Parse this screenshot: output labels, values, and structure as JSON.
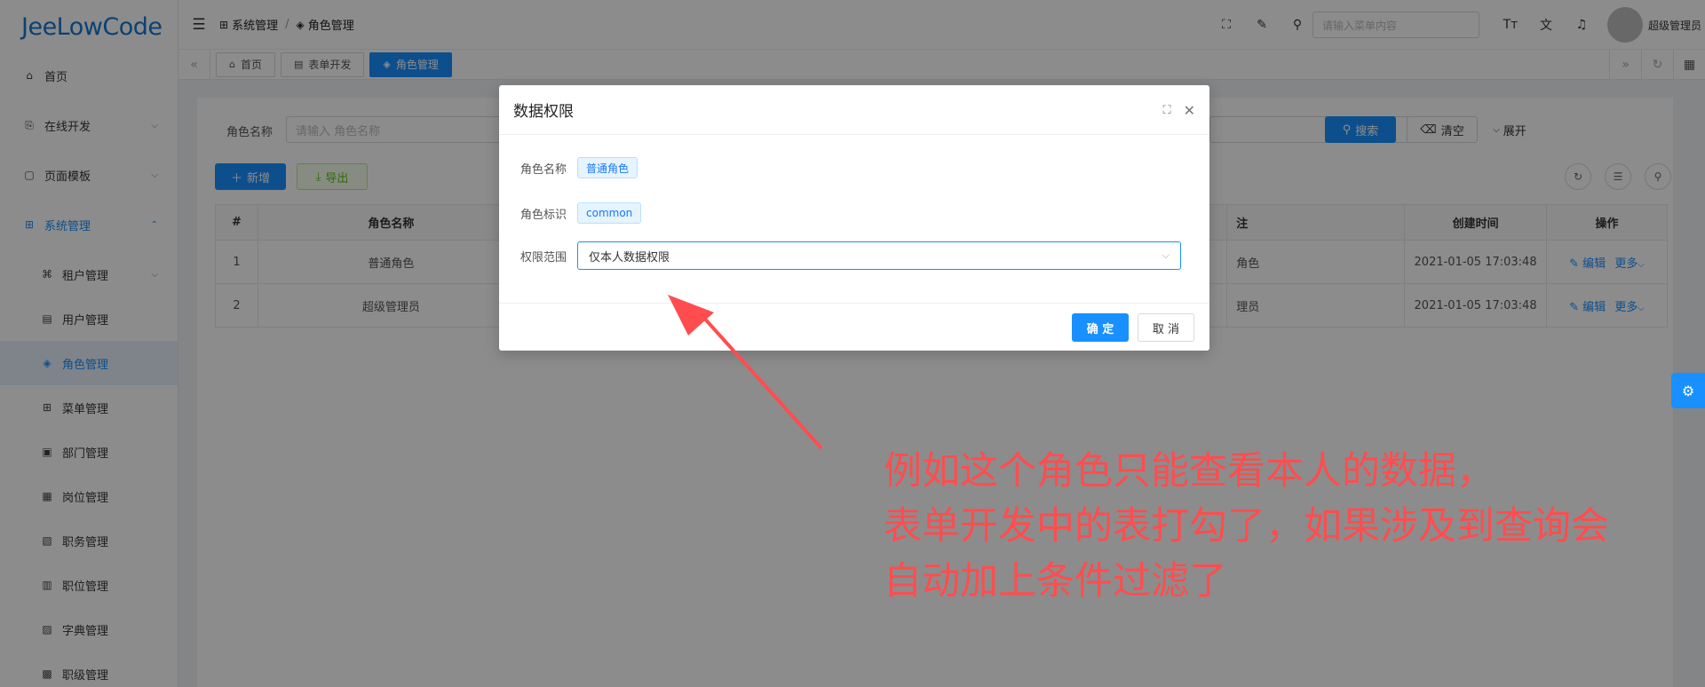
{
  "app": {
    "logo": "JeeLowCode"
  },
  "sidebar": {
    "items": [
      {
        "label": "首页",
        "icon": "home-icon",
        "glyph": "⌂"
      },
      {
        "label": "在线开发",
        "icon": "code-icon",
        "glyph": "⎘"
      },
      {
        "label": "页面模板",
        "icon": "template-icon",
        "glyph": "▢"
      },
      {
        "label": "系统管理",
        "icon": "grid-icon",
        "glyph": "⊞"
      }
    ],
    "sub_items": [
      {
        "label": "租户管理",
        "icon": "tenant-icon",
        "glyph": "⌘"
      },
      {
        "label": "用户管理",
        "icon": "user-icon",
        "glyph": "▤"
      },
      {
        "label": "角色管理",
        "icon": "role-icon",
        "glyph": "◈"
      },
      {
        "label": "菜单管理",
        "icon": "menu-icon",
        "glyph": "⊞"
      },
      {
        "label": "部门管理",
        "icon": "dept-icon",
        "glyph": "▣"
      },
      {
        "label": "岗位管理",
        "icon": "post-icon",
        "glyph": "▦"
      },
      {
        "label": "职务管理",
        "icon": "duty-icon",
        "glyph": "▧"
      },
      {
        "label": "职位管理",
        "icon": "position-icon",
        "glyph": "▥"
      },
      {
        "label": "字典管理",
        "icon": "dict-icon",
        "glyph": "▨"
      },
      {
        "label": "职级管理",
        "icon": "rank-icon",
        "glyph": "▩"
      }
    ]
  },
  "header": {
    "breadcrumb": [
      "系统管理",
      "角色管理"
    ],
    "search_placeholder": "请输入菜单内容",
    "username": "超级管理员"
  },
  "tabs": [
    {
      "label": "首页",
      "glyph": "⌂"
    },
    {
      "label": "表单开发",
      "glyph": "▤"
    },
    {
      "label": "角色管理",
      "glyph": "◈"
    }
  ],
  "search": {
    "role_name_label": "角色名称",
    "role_name_placeholder": "请输入 角色名称",
    "search_button": "搜索",
    "clear_button": "清空",
    "expand_button": "展开"
  },
  "toolbar": {
    "add_button": "新增",
    "export_button": "导出"
  },
  "table": {
    "headers": {
      "index": "#",
      "role_name": "角色名称",
      "remark": "注",
      "created": "创建时间",
      "ops": "操作"
    },
    "rows": [
      {
        "index": "1",
        "role_name": "普通角色",
        "remark": "角色",
        "created": "2021-01-05 17:03:48",
        "edit": "编辑",
        "more": "更多"
      },
      {
        "index": "2",
        "role_name": "超级管理员",
        "remark": "理员",
        "created": "2021-01-05 17:03:48",
        "edit": "编辑",
        "more": "更多"
      }
    ]
  },
  "modal": {
    "title": "数据权限",
    "fields": {
      "role_name_label": "角色名称",
      "role_name_value": "普通角色",
      "role_key_label": "角色标识",
      "role_key_value": "common",
      "scope_label": "权限范围",
      "scope_value": "仅本人数据权限"
    },
    "ok_button": "确 定",
    "cancel_button": "取 消"
  },
  "annotation": {
    "lines": [
      "例如这个角色只能查看本人的数据，",
      "表单开发中的表打勾了，如果涉及到查询会",
      "自动加上条件过滤了"
    ],
    "color": "#ff4d4f"
  },
  "colors": {
    "primary": "#1890ff",
    "success": "#52c41a"
  }
}
